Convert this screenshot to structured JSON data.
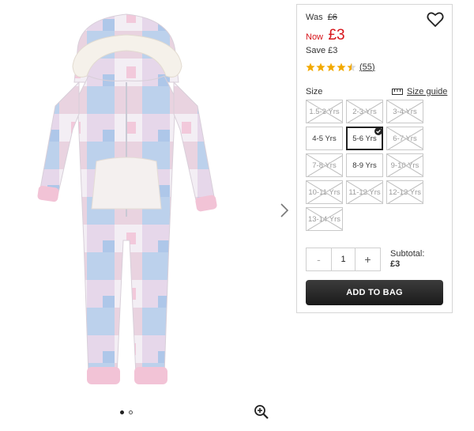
{
  "product": {
    "image_alt": "Check fleece hooded onesie",
    "carousel": {
      "total_images": 2,
      "active_index": 0
    }
  },
  "price": {
    "was_label": "Was",
    "was_amount": "£6",
    "now_label": "Now",
    "now_amount": "£3",
    "save_label": "Save",
    "save_amount": "£3"
  },
  "rating": {
    "stars": 4.5,
    "count": "55"
  },
  "size": {
    "label": "Size",
    "guide_label": "Size guide",
    "options": [
      {
        "label": "1.5-2 Yrs",
        "available": false,
        "selected": false
      },
      {
        "label": "2-3 Yrs",
        "available": false,
        "selected": false
      },
      {
        "label": "3-4 Yrs",
        "available": false,
        "selected": false
      },
      {
        "label": "4-5 Yrs",
        "available": true,
        "selected": false
      },
      {
        "label": "5-6 Yrs",
        "available": true,
        "selected": true
      },
      {
        "label": "6-7 Yrs",
        "available": false,
        "selected": false
      },
      {
        "label": "7-8 Yrs",
        "available": false,
        "selected": false
      },
      {
        "label": "8-9 Yrs",
        "available": true,
        "selected": false
      },
      {
        "label": "9-10 Yrs",
        "available": false,
        "selected": false
      },
      {
        "label": "10-11 Yrs",
        "available": false,
        "selected": false
      },
      {
        "label": "11-12 Yrs",
        "available": false,
        "selected": false
      },
      {
        "label": "12-13 Yrs",
        "available": false,
        "selected": false
      },
      {
        "label": "13-14 Yrs",
        "available": false,
        "selected": false
      }
    ]
  },
  "quantity": {
    "minus": "-",
    "value": "1",
    "plus": "+"
  },
  "subtotal": {
    "label": "Subtotal:",
    "value": "£3"
  },
  "add_to_bag": "ADD TO BAG",
  "icons": {
    "wishlist": "heart-icon",
    "rating": "star-icon",
    "size_guide": "ruler-icon",
    "next": "chevron-right-icon",
    "zoom": "zoom-in-icon",
    "selected": "check-icon"
  },
  "colors": {
    "price_red": "#d7141a",
    "button_dark": "#222222",
    "star_gold": "#f2a900"
  }
}
